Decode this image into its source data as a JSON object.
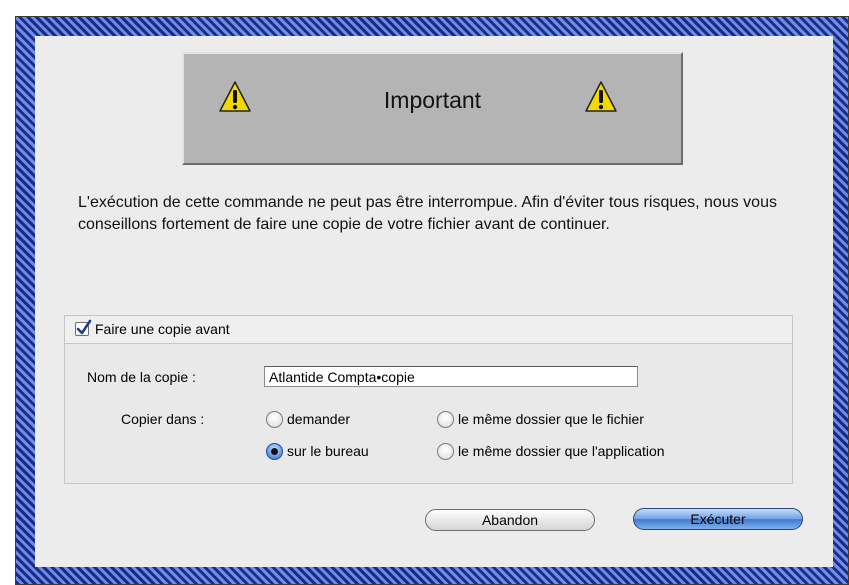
{
  "banner": {
    "title": "Important",
    "icon": "warning-icon"
  },
  "message": "L'exécution de cette commande ne peut pas être interrompue. Afin d'éviter tous risques, nous vous conseillons fortement de faire une copie de votre fichier avant de continuer.",
  "copy_option": {
    "label": "Faire une copie avant",
    "checked": true
  },
  "copy_name": {
    "label": "Nom de la copie :",
    "value": "Atlantide Compta•copie"
  },
  "copy_dest": {
    "label": "Copier dans :",
    "options": [
      {
        "label": "demander",
        "selected": false
      },
      {
        "label": "le même dossier que le fichier",
        "selected": false
      },
      {
        "label": "sur le bureau",
        "selected": true
      },
      {
        "label": "le même dossier que l'application",
        "selected": false
      }
    ]
  },
  "buttons": {
    "cancel": "Abandon",
    "ok": "Exécuter"
  },
  "colors": {
    "accent": "#3f7ad0",
    "frame_stripe_dark": "#1c2a8c",
    "frame_stripe_light": "#6e8fe0",
    "warning": "#f2d600"
  }
}
